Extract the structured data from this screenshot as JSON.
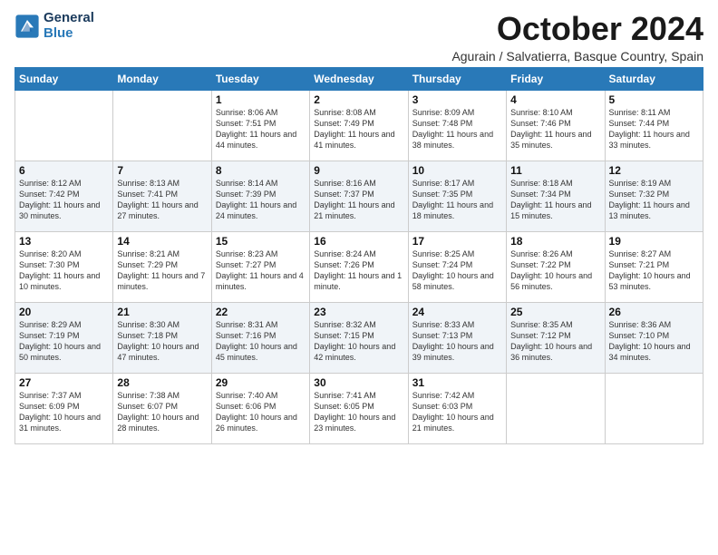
{
  "header": {
    "logo_general": "General",
    "logo_blue": "Blue",
    "month_title": "October 2024",
    "subtitle": "Agurain / Salvatierra, Basque Country, Spain"
  },
  "weekdays": [
    "Sunday",
    "Monday",
    "Tuesday",
    "Wednesday",
    "Thursday",
    "Friday",
    "Saturday"
  ],
  "weeks": [
    [
      {
        "day": "",
        "info": ""
      },
      {
        "day": "",
        "info": ""
      },
      {
        "day": "1",
        "info": "Sunrise: 8:06 AM\nSunset: 7:51 PM\nDaylight: 11 hours and 44 minutes."
      },
      {
        "day": "2",
        "info": "Sunrise: 8:08 AM\nSunset: 7:49 PM\nDaylight: 11 hours and 41 minutes."
      },
      {
        "day": "3",
        "info": "Sunrise: 8:09 AM\nSunset: 7:48 PM\nDaylight: 11 hours and 38 minutes."
      },
      {
        "day": "4",
        "info": "Sunrise: 8:10 AM\nSunset: 7:46 PM\nDaylight: 11 hours and 35 minutes."
      },
      {
        "day": "5",
        "info": "Sunrise: 8:11 AM\nSunset: 7:44 PM\nDaylight: 11 hours and 33 minutes."
      }
    ],
    [
      {
        "day": "6",
        "info": "Sunrise: 8:12 AM\nSunset: 7:42 PM\nDaylight: 11 hours and 30 minutes."
      },
      {
        "day": "7",
        "info": "Sunrise: 8:13 AM\nSunset: 7:41 PM\nDaylight: 11 hours and 27 minutes."
      },
      {
        "day": "8",
        "info": "Sunrise: 8:14 AM\nSunset: 7:39 PM\nDaylight: 11 hours and 24 minutes."
      },
      {
        "day": "9",
        "info": "Sunrise: 8:16 AM\nSunset: 7:37 PM\nDaylight: 11 hours and 21 minutes."
      },
      {
        "day": "10",
        "info": "Sunrise: 8:17 AM\nSunset: 7:35 PM\nDaylight: 11 hours and 18 minutes."
      },
      {
        "day": "11",
        "info": "Sunrise: 8:18 AM\nSunset: 7:34 PM\nDaylight: 11 hours and 15 minutes."
      },
      {
        "day": "12",
        "info": "Sunrise: 8:19 AM\nSunset: 7:32 PM\nDaylight: 11 hours and 13 minutes."
      }
    ],
    [
      {
        "day": "13",
        "info": "Sunrise: 8:20 AM\nSunset: 7:30 PM\nDaylight: 11 hours and 10 minutes."
      },
      {
        "day": "14",
        "info": "Sunrise: 8:21 AM\nSunset: 7:29 PM\nDaylight: 11 hours and 7 minutes."
      },
      {
        "day": "15",
        "info": "Sunrise: 8:23 AM\nSunset: 7:27 PM\nDaylight: 11 hours and 4 minutes."
      },
      {
        "day": "16",
        "info": "Sunrise: 8:24 AM\nSunset: 7:26 PM\nDaylight: 11 hours and 1 minute."
      },
      {
        "day": "17",
        "info": "Sunrise: 8:25 AM\nSunset: 7:24 PM\nDaylight: 10 hours and 58 minutes."
      },
      {
        "day": "18",
        "info": "Sunrise: 8:26 AM\nSunset: 7:22 PM\nDaylight: 10 hours and 56 minutes."
      },
      {
        "day": "19",
        "info": "Sunrise: 8:27 AM\nSunset: 7:21 PM\nDaylight: 10 hours and 53 minutes."
      }
    ],
    [
      {
        "day": "20",
        "info": "Sunrise: 8:29 AM\nSunset: 7:19 PM\nDaylight: 10 hours and 50 minutes."
      },
      {
        "day": "21",
        "info": "Sunrise: 8:30 AM\nSunset: 7:18 PM\nDaylight: 10 hours and 47 minutes."
      },
      {
        "day": "22",
        "info": "Sunrise: 8:31 AM\nSunset: 7:16 PM\nDaylight: 10 hours and 45 minutes."
      },
      {
        "day": "23",
        "info": "Sunrise: 8:32 AM\nSunset: 7:15 PM\nDaylight: 10 hours and 42 minutes."
      },
      {
        "day": "24",
        "info": "Sunrise: 8:33 AM\nSunset: 7:13 PM\nDaylight: 10 hours and 39 minutes."
      },
      {
        "day": "25",
        "info": "Sunrise: 8:35 AM\nSunset: 7:12 PM\nDaylight: 10 hours and 36 minutes."
      },
      {
        "day": "26",
        "info": "Sunrise: 8:36 AM\nSunset: 7:10 PM\nDaylight: 10 hours and 34 minutes."
      }
    ],
    [
      {
        "day": "27",
        "info": "Sunrise: 7:37 AM\nSunset: 6:09 PM\nDaylight: 10 hours and 31 minutes."
      },
      {
        "day": "28",
        "info": "Sunrise: 7:38 AM\nSunset: 6:07 PM\nDaylight: 10 hours and 28 minutes."
      },
      {
        "day": "29",
        "info": "Sunrise: 7:40 AM\nSunset: 6:06 PM\nDaylight: 10 hours and 26 minutes."
      },
      {
        "day": "30",
        "info": "Sunrise: 7:41 AM\nSunset: 6:05 PM\nDaylight: 10 hours and 23 minutes."
      },
      {
        "day": "31",
        "info": "Sunrise: 7:42 AM\nSunset: 6:03 PM\nDaylight: 10 hours and 21 minutes."
      },
      {
        "day": "",
        "info": ""
      },
      {
        "day": "",
        "info": ""
      }
    ]
  ]
}
